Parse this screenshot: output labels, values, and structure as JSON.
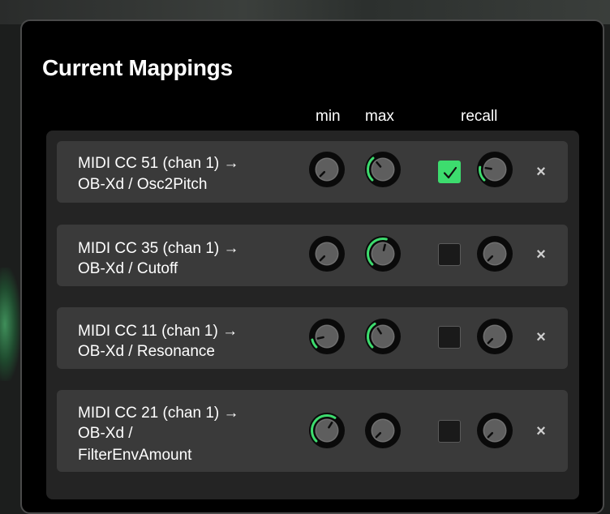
{
  "panel": {
    "title": "Current Mappings",
    "columns": {
      "min": "min",
      "max": "max",
      "recall": "recall"
    }
  },
  "colors": {
    "accent_green": "#3ddc6e",
    "row_bg": "#3a3a3a",
    "list_bg": "#242424",
    "panel_bg": "#000000"
  },
  "close_glyph": "×",
  "mappings": [
    {
      "line1": "MIDI CC 51 (chan 1) →",
      "line2": "OB-Xd / Osc2Pitch",
      "line3": "",
      "min": 0.0,
      "max": 0.35,
      "recall_enabled": true,
      "recall": 0.2
    },
    {
      "line1": "MIDI CC 35 (chan 1) →",
      "line2": "OB-Xd / Cutoff",
      "line3": "",
      "min": 0.0,
      "max": 0.55,
      "recall_enabled": false,
      "recall": 0.0
    },
    {
      "line1": "MIDI CC 11 (chan 1) →",
      "line2": "OB-Xd / Resonance",
      "line3": "",
      "min": 0.12,
      "max": 0.38,
      "recall_enabled": false,
      "recall": 0.0
    },
    {
      "line1": "MIDI CC 21 (chan 1) →",
      "line2": "OB-Xd /",
      "line3": "FilterEnvAmount",
      "min": 0.62,
      "max": 0.0,
      "recall_enabled": false,
      "recall": 0.0
    }
  ]
}
